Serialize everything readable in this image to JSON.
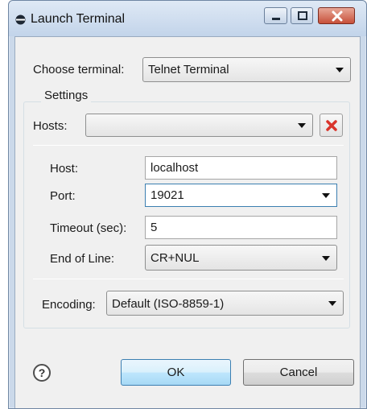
{
  "window": {
    "title": "Launch Terminal"
  },
  "choose_terminal": {
    "label": "Choose terminal:",
    "value": "Telnet Terminal"
  },
  "settings": {
    "title": "Settings",
    "hosts_label": "Hosts:",
    "hosts_value": "",
    "host": {
      "label": "Host:",
      "value": "localhost"
    },
    "port": {
      "label": "Port:",
      "value": "19021"
    },
    "timeout": {
      "label": "Timeout (sec):",
      "value": "5"
    },
    "end_of_line": {
      "label": "End of Line:",
      "value": "CR+NUL"
    },
    "encoding": {
      "label": "Encoding:",
      "value": "Default (ISO-8859-1)"
    }
  },
  "buttons": {
    "help": "?",
    "ok": "OK",
    "cancel": "Cancel"
  },
  "icons": {
    "app": "terminal-icon",
    "minimize": "minimize-icon",
    "maximize": "maximize-icon",
    "close": "close-icon",
    "delete": "delete-x-icon",
    "help": "help-icon"
  },
  "colors": {
    "delete_red": "#d9342b",
    "title_gradient_top": "#dfe9f5"
  }
}
